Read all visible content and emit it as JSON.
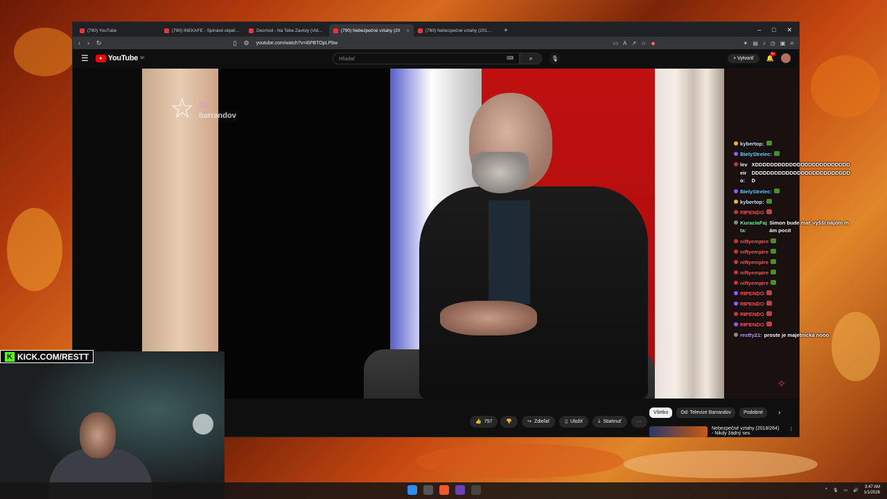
{
  "browser": {
    "tabs": [
      {
        "title": "(790) YouTube",
        "active": false
      },
      {
        "title": "(790) INEKAFE - Špinavé objatie - Yo",
        "active": false
      },
      {
        "title": "Desmod - Na Tebe Zavisly (Video) -",
        "active": false
      },
      {
        "title": "(790) Nebezpečné vztahy (20",
        "active": true
      },
      {
        "title": "(790) Nebezpečné vztahy (2019/258",
        "active": false
      }
    ],
    "new_tab": "+",
    "url": "youtube.com/watch?v=i6PBTOpLPbw",
    "window_controls": [
      "–",
      "□",
      "✕"
    ]
  },
  "youtube": {
    "logo": "YouTube",
    "country": "SK",
    "search_placeholder": "Hľadať",
    "create_label": "Vytvoriť",
    "notifications": "9+",
    "actions": {
      "likes": "757",
      "share": "Zdieľať",
      "save": "Uložiť",
      "download": "Stiahnuť",
      "more": "···"
    },
    "chips": [
      "Všetko",
      "Od: Televize Barrandov",
      "Podobné"
    ],
    "rec_title": "Nebezpečné vztahy (2018/264)",
    "rec_subtitle": "- Nikdy žádný sex"
  },
  "video": {
    "watermark_tv": "tv",
    "watermark_brand": "barrandov"
  },
  "chat": [
    {
      "user": "kybertop:",
      "msg": "",
      "color": "#cfe7ff",
      "badge": "#f2b705",
      "emote": "green"
    },
    {
      "user": "BielyStrelec:",
      "msg": "",
      "color": "#62d3ff",
      "badge": "#8a5cff",
      "emote": "green"
    },
    {
      "user": "leveiro:",
      "msg": "XDDDDDDDDDDDDDDDDDDDDDDDDDDDDDDDDDDDDDDDDDDDDDDDDDDDD",
      "color": "#ffffff",
      "badge": "#c33",
      "emote": ""
    },
    {
      "user": "BielyStrelec:",
      "msg": "",
      "color": "#62d3ff",
      "badge": "#8a5cff",
      "emote": "green"
    },
    {
      "user": "kybertop:",
      "msg": "",
      "color": "#cfe7ff",
      "badge": "#f2b705",
      "emote": "green"
    },
    {
      "user": "RIPENDO",
      "msg": "",
      "color": "#ff4d4d",
      "badge": "#c33",
      "emote": "red"
    },
    {
      "user": "KuraciaFajta:",
      "msg": "Simon bude mať vyšší nájom mám pocit",
      "color": "#6cf29b",
      "badge": "#888",
      "emote": ""
    },
    {
      "user": "niftyempire",
      "msg": "",
      "color": "#ff5959",
      "badge": "#c33",
      "emote": "green"
    },
    {
      "user": "niftyempire",
      "msg": "",
      "color": "#ff5959",
      "badge": "#c33",
      "emote": "green"
    },
    {
      "user": "niftyempire",
      "msg": "",
      "color": "#ff5959",
      "badge": "#c33",
      "emote": "green"
    },
    {
      "user": "niftyempire",
      "msg": "",
      "color": "#ff5959",
      "badge": "#c33",
      "emote": "green"
    },
    {
      "user": "niftyempire",
      "msg": "",
      "color": "#ff5959",
      "badge": "#c33",
      "emote": "green"
    },
    {
      "user": "RIPENDO",
      "msg": "",
      "color": "#ff4d4d",
      "badge": "#8a5cff",
      "emote": "red"
    },
    {
      "user": "RIPENDO",
      "msg": "",
      "color": "#ff4d4d",
      "badge": "#8a5cff",
      "emote": "red"
    },
    {
      "user": "RIPENDO",
      "msg": "",
      "color": "#ff4d4d",
      "badge": "#c33",
      "emote": "red"
    },
    {
      "user": "RIPENDO",
      "msg": "",
      "color": "#ff4d4d",
      "badge": "#8a5cff",
      "emote": "red"
    },
    {
      "user": "restty21:",
      "msg": "proste je majetnícka nooo",
      "color": "#c79cff",
      "badge": "#888",
      "emote": ""
    }
  ],
  "stream": {
    "kick_label": "KICK.COM/RESTT"
  },
  "taskbar": {
    "time": "3:47 AM",
    "date": "1/1/2026"
  }
}
